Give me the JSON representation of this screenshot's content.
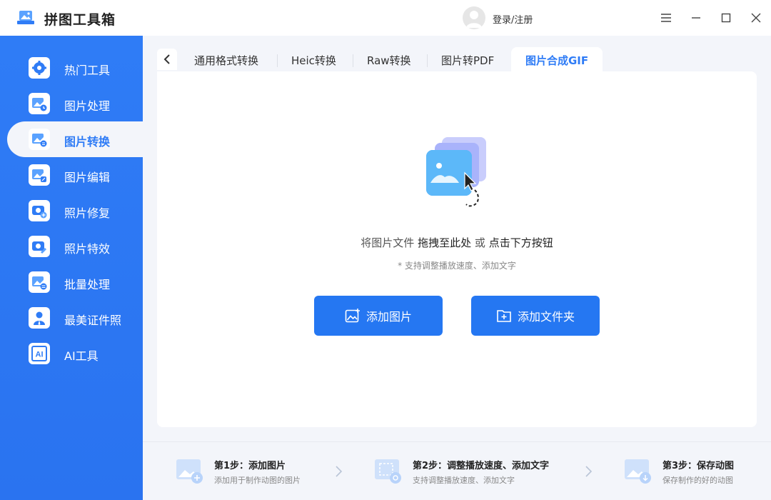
{
  "app": {
    "title": "拼图工具箱",
    "login": "登录/注册"
  },
  "colors": {
    "accent": "#2577f2",
    "sidebar": "#2f7cf6",
    "background": "#f3f5fa"
  },
  "window_controls": [
    "menu-icon",
    "minimize-icon",
    "maximize-icon",
    "close-icon"
  ],
  "sidebar": {
    "items": [
      {
        "label": "热门工具",
        "icon": "tools-icon"
      },
      {
        "label": "图片处理",
        "icon": "image-process-icon"
      },
      {
        "label": "图片转换",
        "icon": "image-convert-icon",
        "active": true
      },
      {
        "label": "图片编辑",
        "icon": "image-edit-icon"
      },
      {
        "label": "照片修复",
        "icon": "photo-repair-icon"
      },
      {
        "label": "照片特效",
        "icon": "photo-effect-icon"
      },
      {
        "label": "批量处理",
        "icon": "batch-icon"
      },
      {
        "label": "最美证件照",
        "icon": "id-photo-icon"
      },
      {
        "label": "AI工具",
        "icon": "ai-icon"
      }
    ]
  },
  "tabs": [
    {
      "label": "通用格式转换"
    },
    {
      "label": "Heic转换"
    },
    {
      "label": "Raw转换"
    },
    {
      "label": "图片转PDF"
    },
    {
      "label": "图片合成GIF",
      "active": true
    }
  ],
  "main": {
    "hint_prefix": "将图片文件",
    "hint_drag": "拖拽至此处",
    "hint_or": "或",
    "hint_click": "点击下方按钮",
    "hint_sub": "* 支持调整播放速度、添加文字",
    "add_image_button": "添加图片",
    "add_folder_button": "添加文件夹"
  },
  "steps": [
    {
      "title": "第1步：添加图片",
      "desc": "添加用于制作动图的图片"
    },
    {
      "title": "第2步：调整播放速度、添加文字",
      "desc": "支持调整播放速度、添加文字"
    },
    {
      "title": "第3步：保存动图",
      "desc": "保存制作的好的动图"
    }
  ]
}
